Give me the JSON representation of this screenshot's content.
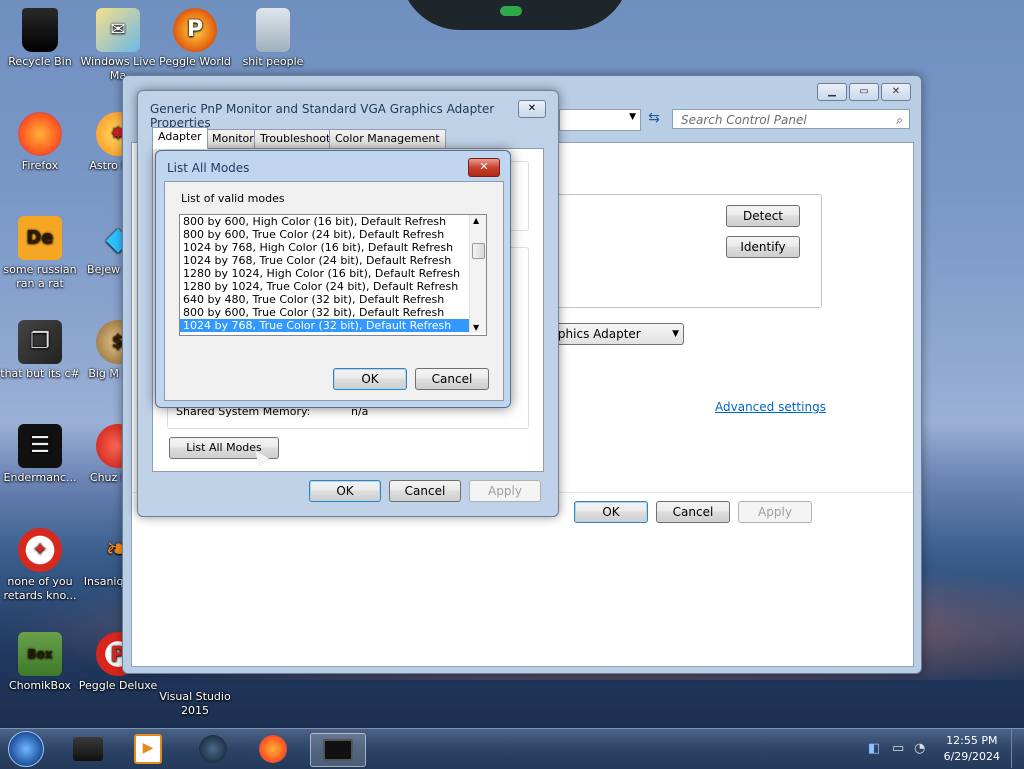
{
  "desktop": {
    "icons": [
      {
        "label": "Recycle Bin"
      },
      {
        "label": "Windows Live Ma"
      },
      {
        "label": "Peggle World"
      },
      {
        "label": "shit people"
      },
      {
        "label": "Firefox"
      },
      {
        "label": "Astro Delu"
      },
      {
        "label": "some russian ran a rat"
      },
      {
        "label": "Bejew Delu"
      },
      {
        "label": "that but its c#"
      },
      {
        "label": "Big M Delu"
      },
      {
        "label": "Endermanc..."
      },
      {
        "label": "Chuz Delu"
      },
      {
        "label": "none of you retards kno..."
      },
      {
        "label": "Insaniq Delu"
      },
      {
        "label": "ChomikBox"
      },
      {
        "label": "Peggle Deluxe"
      },
      {
        "label": "Visual Studio 2015"
      }
    ]
  },
  "control_panel": {
    "search_placeholder": "Search Control Panel",
    "detect_label": "Detect",
    "identify_label": "Identify",
    "display_dropdown": "GA Graphics Adapter",
    "advanced_link": "Advanced settings",
    "ok_label": "OK",
    "cancel_label": "Cancel",
    "apply_label": "Apply"
  },
  "properties": {
    "title": "Generic PnP Monitor and Standard VGA Graphics Adapter Properties",
    "tabs": [
      {
        "label": "Adapter"
      },
      {
        "label": "Monitor"
      },
      {
        "label": "Troubleshoot"
      },
      {
        "label": "Color Management"
      }
    ],
    "shared_memory_label": "Shared System Memory:",
    "shared_memory_value": "n/a",
    "list_all_modes_button": "List All Modes",
    "ok_label": "OK",
    "cancel_label": "Cancel",
    "apply_label": "Apply"
  },
  "list_all_modes": {
    "title": "List All Modes",
    "close_icon": "close-icon",
    "group_label": "List of valid modes",
    "modes": [
      "800 by 600, High Color (16 bit), Default Refresh",
      "800 by 600, True Color (24 bit), Default Refresh",
      "1024 by 768, High Color (16 bit), Default Refresh",
      "1024 by 768, True Color (24 bit), Default Refresh",
      "1280 by 1024, High Color (16 bit), Default Refresh",
      "1280 by 1024, True Color (24 bit), Default Refresh",
      "640 by 480, True Color (32 bit), Default Refresh",
      "800 by 600, True Color (32 bit), Default Refresh",
      "1024 by 768, True Color (32 bit), Default Refresh"
    ],
    "selected_index": 8,
    "ok_label": "OK",
    "cancel_label": "Cancel"
  },
  "taskbar": {
    "time": "12:55 PM",
    "date": "6/29/2024"
  },
  "colors": {
    "selection": "#3399ff",
    "link": "#0066cc",
    "close_red": "#c7412d"
  }
}
